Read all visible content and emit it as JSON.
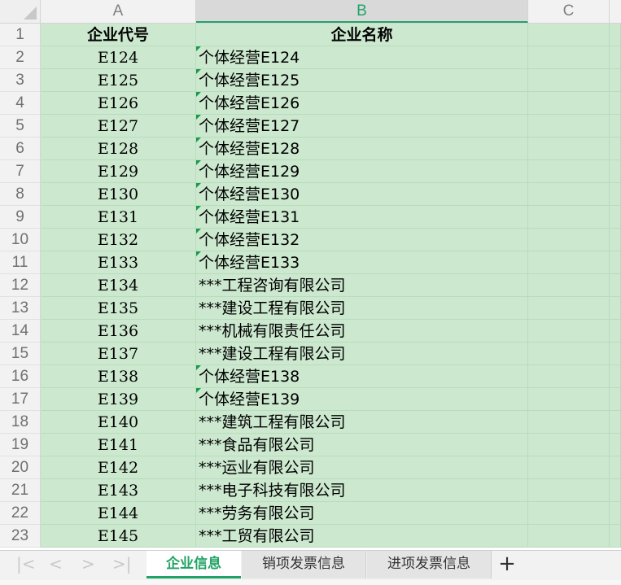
{
  "columns": [
    "A",
    "B",
    "C"
  ],
  "header_row": {
    "row_number": "1",
    "col_a": "企业代号",
    "col_b": "企业名称"
  },
  "rows": [
    {
      "n": "2",
      "code": "E124",
      "name": "个体经营E124",
      "flag": true
    },
    {
      "n": "3",
      "code": "E125",
      "name": "个体经营E125",
      "flag": true
    },
    {
      "n": "4",
      "code": "E126",
      "name": "个体经营E126",
      "flag": true
    },
    {
      "n": "5",
      "code": "E127",
      "name": "个体经营E127",
      "flag": true
    },
    {
      "n": "6",
      "code": "E128",
      "name": "个体经营E128",
      "flag": true
    },
    {
      "n": "7",
      "code": "E129",
      "name": "个体经营E129",
      "flag": true
    },
    {
      "n": "8",
      "code": "E130",
      "name": "个体经营E130",
      "flag": true
    },
    {
      "n": "9",
      "code": "E131",
      "name": "个体经营E131",
      "flag": true
    },
    {
      "n": "10",
      "code": "E132",
      "name": "个体经营E132",
      "flag": true
    },
    {
      "n": "11",
      "code": "E133",
      "name": "个体经营E133",
      "flag": true
    },
    {
      "n": "12",
      "code": "E134",
      "name": "***工程咨询有限公司",
      "flag": false
    },
    {
      "n": "13",
      "code": "E135",
      "name": "***建设工程有限公司",
      "flag": false
    },
    {
      "n": "14",
      "code": "E136",
      "name": "***机械有限责任公司",
      "flag": false
    },
    {
      "n": "15",
      "code": "E137",
      "name": "***建设工程有限公司",
      "flag": false
    },
    {
      "n": "16",
      "code": "E138",
      "name": "个体经营E138",
      "flag": true
    },
    {
      "n": "17",
      "code": "E139",
      "name": "个体经营E139",
      "flag": true
    },
    {
      "n": "18",
      "code": "E140",
      "name": "***建筑工程有限公司",
      "flag": false
    },
    {
      "n": "19",
      "code": "E141",
      "name": "***食品有限公司",
      "flag": false
    },
    {
      "n": "20",
      "code": "E142",
      "name": "***运业有限公司",
      "flag": false
    },
    {
      "n": "21",
      "code": "E143",
      "name": "***电子科技有限公司",
      "flag": false
    },
    {
      "n": "22",
      "code": "E144",
      "name": "***劳务有限公司",
      "flag": false
    },
    {
      "n": "23",
      "code": "E145",
      "name": "***工贸有限公司",
      "flag": false
    }
  ],
  "sheet_tabs": [
    {
      "label": "企业信息",
      "active": true
    },
    {
      "label": "销项发票信息",
      "active": false
    },
    {
      "label": "进项发票信息",
      "active": false
    }
  ],
  "nav_glyphs": {
    "first": "|<",
    "prev": "<",
    "next": ">",
    "last": ">|"
  },
  "add_sheet_glyph": "+",
  "colors": {
    "cell_fill": "#cce8cf",
    "accent": "#21a366",
    "comment_flag": "#169c4a"
  }
}
